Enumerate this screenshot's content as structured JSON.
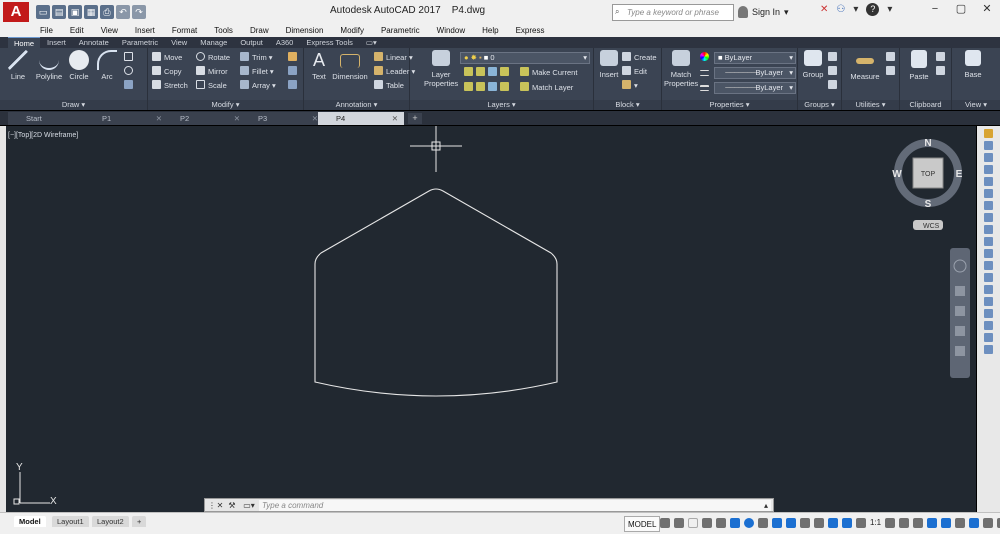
{
  "app": {
    "logo_letter": "A",
    "title": "Autodesk AutoCAD 2017",
    "filename": "P4.dwg",
    "search_placeholder": "Type a keyword or phrase",
    "signin_label": "Sign In",
    "brand_color": "#c21a1a"
  },
  "quick_access": [
    "new-icon",
    "open-icon",
    "save-icon",
    "save-as-icon",
    "print-icon",
    "undo-icon",
    "redo-icon"
  ],
  "menu": [
    "File",
    "Edit",
    "View",
    "Insert",
    "Format",
    "Tools",
    "Draw",
    "Dimension",
    "Modify",
    "Parametric",
    "Window",
    "Help",
    "Express"
  ],
  "ribbon_tabs": [
    "Home",
    "Insert",
    "Annotate",
    "Parametric",
    "View",
    "Manage",
    "Output",
    "A360",
    "Express Tools"
  ],
  "ribbon": {
    "draw": {
      "title": "Draw",
      "line": "Line",
      "polyline": "Polyline",
      "circle": "Circle",
      "arc": "Arc"
    },
    "modify": {
      "title": "Modify",
      "move": "Move",
      "rotate": "Rotate",
      "trim": "Trim",
      "copy": "Copy",
      "mirror": "Mirror",
      "fillet": "Fillet",
      "stretch": "Stretch",
      "scale": "Scale",
      "array": "Array"
    },
    "annotation": {
      "title": "Annotation",
      "text": "Text",
      "dimension": "Dimension",
      "linear": "Linear",
      "leader": "Leader",
      "table": "Table"
    },
    "layers": {
      "title": "Layers",
      "layer_properties_1": "Layer",
      "layer_properties_2": "Properties",
      "current_layer": "0",
      "make_current": "Make Current",
      "match_layer": "Match Layer"
    },
    "block": {
      "title": "Block",
      "insert": "Insert",
      "create": "Create",
      "edit": "Edit"
    },
    "properties": {
      "title": "Properties",
      "match_1": "Match",
      "match_2": "Properties",
      "color": "ByLayer",
      "linetype": "ByLayer",
      "lineweight": "ByLayer"
    },
    "groups": {
      "title": "Groups",
      "group": "Group"
    },
    "utilities": {
      "title": "Utilities",
      "measure": "Measure"
    },
    "clipboard": {
      "title": "Clipboard",
      "paste": "Paste"
    },
    "view": {
      "title": "View",
      "base": "Base"
    }
  },
  "doc_tabs": [
    "Start",
    "P1",
    "P2",
    "P3",
    "P4"
  ],
  "viewport_label": "[−][Top][2D Wireframe]",
  "viewcube": {
    "north": "N",
    "south": "S",
    "east": "E",
    "west": "W",
    "face": "TOP",
    "wcs": "WCS"
  },
  "ucs": {
    "x": "X",
    "y": "Y"
  },
  "command": {
    "placeholder": "Type a command"
  },
  "layout_tabs": [
    "Model",
    "Layout1",
    "Layout2"
  ],
  "status": {
    "model": "MODEL",
    "scale": "1:1"
  }
}
